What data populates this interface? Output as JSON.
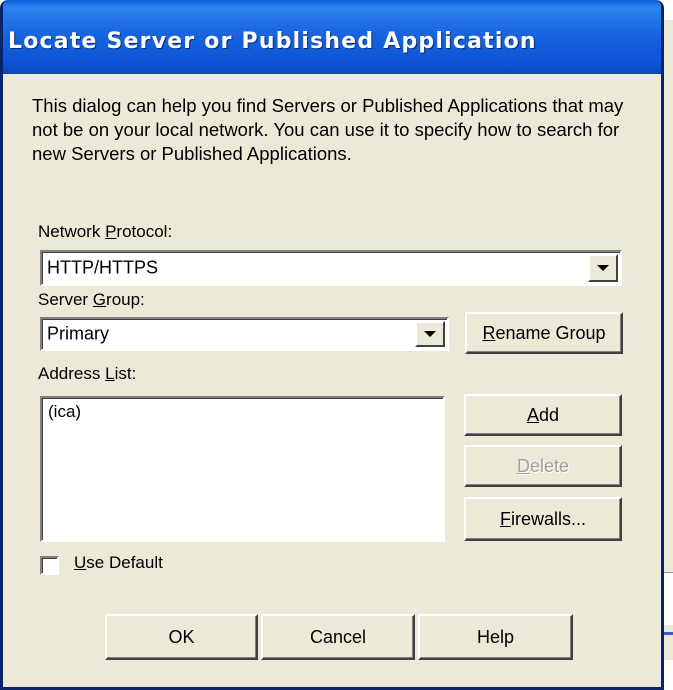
{
  "window": {
    "title": "Locate Server or Published Application"
  },
  "description": "This dialog can help you find Servers or Published Applications that may not be on your local network.  You can use it to specify how to search for new Servers or Published Applications.",
  "network_protocol": {
    "label_pre": "Network ",
    "label_accel": "P",
    "label_post": "rotocol:",
    "value": "HTTP/HTTPS"
  },
  "server_group": {
    "label_pre": "Server ",
    "label_accel": "G",
    "label_post": "roup:",
    "value": "Primary",
    "rename_pre": "",
    "rename_accel": "R",
    "rename_post": "ename Group"
  },
  "address_list": {
    "label_pre": "Address ",
    "label_accel": "L",
    "label_post": "ist:",
    "items": [
      "(ica)"
    ]
  },
  "side_buttons": {
    "add_accel": "A",
    "add_post": "dd",
    "delete_accel": "D",
    "delete_post": "elete",
    "firewalls_accel": "F",
    "firewalls_post": "irewalls..."
  },
  "use_default": {
    "accel": "U",
    "post": "se Default",
    "checked": false
  },
  "footer_buttons": {
    "ok": "OK",
    "cancel": "Cancel",
    "help": "Help"
  },
  "colors": {
    "title_bar": "#0a5fd8",
    "dialog_bg": "#ece9d8",
    "disabled_text": "#a0a0a0"
  }
}
